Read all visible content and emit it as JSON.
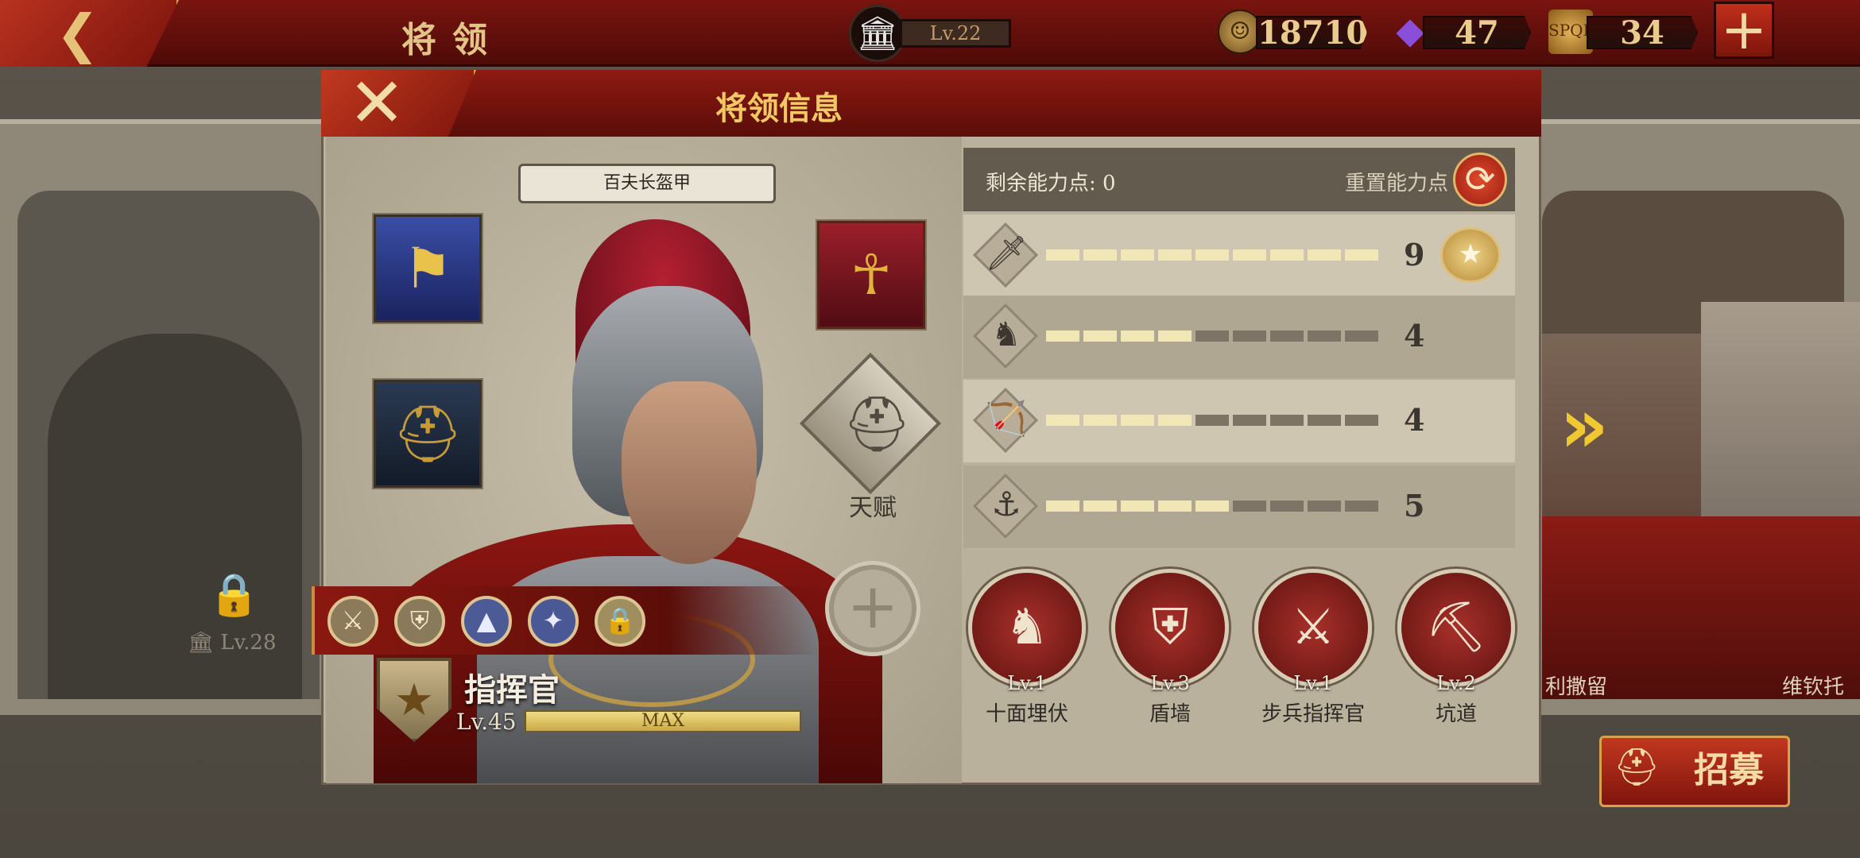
{
  "topbar": {
    "back_icon": "back-arrow-icon",
    "title": "将领",
    "senate_level": "Lv.22",
    "coins": "18710",
    "gems": "47",
    "tokens": "34",
    "add_icon": "plus-icon"
  },
  "background": {
    "locked_level": "Lv.28",
    "right_name_1": "利撒留",
    "right_name_2": "维钦托",
    "recruit_label": "招募"
  },
  "dialog": {
    "title": "将领信息",
    "armor_label": "百夫长盔甲",
    "talent_label": "天赋",
    "rank_name": "指挥官",
    "level": "Lv.45",
    "level_bar_text": "MAX",
    "level_progress": 1.0
  },
  "stats": {
    "remaining_label": "剩余能力点: 0",
    "reset_label": "重置能力点",
    "rows": [
      {
        "name": "sword",
        "filled": 9,
        "total": 9,
        "value": "9"
      },
      {
        "name": "horse",
        "filled": 4,
        "total": 9,
        "value": "4"
      },
      {
        "name": "bow",
        "filled": 4,
        "total": 9,
        "value": "4"
      },
      {
        "name": "anchor",
        "filled": 5,
        "total": 9,
        "value": "5"
      }
    ]
  },
  "tactics": [
    {
      "level": "Lv.1",
      "name": "十面埋伏"
    },
    {
      "level": "Lv.3",
      "name": "盾墙"
    },
    {
      "level": "Lv.1",
      "name": "步兵指挥官"
    },
    {
      "level": "Lv.2",
      "name": "坑道"
    }
  ],
  "colors": {
    "banner_red": "#7a1410",
    "gold_text": "#e3c488",
    "panel_bg": "#bab19d",
    "bar_on": "#f1e7b6",
    "bar_off": "#7d7465"
  }
}
